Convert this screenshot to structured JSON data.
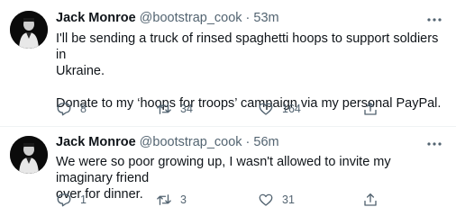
{
  "tweets": [
    {
      "name": "Jack Monroe",
      "handle": "@bootstrap_cook",
      "separator": "·",
      "time": "53m",
      "lines": [
        "I'll be sending a truck of rinsed spaghetti hoops to support soldiers in",
        "Ukraine.",
        "Donate to my ‘hoops for troops’ campaign via my personal PayPal."
      ],
      "replies": "8",
      "retweets": "34",
      "likes": "164"
    },
    {
      "name": "Jack Monroe",
      "handle": "@bootstrap_cook",
      "separator": "·",
      "time": "56m",
      "lines": [
        "We were so poor growing up, I wasn't allowed to invite my imaginary friend",
        "over for dinner."
      ],
      "replies": "1",
      "retweets": "3",
      "likes": "31"
    }
  ],
  "icons": {
    "avatar": "profile-photo",
    "more": "more-horizontal-icon",
    "reply": "reply-icon",
    "retweet": "retweet-icon",
    "like": "heart-icon",
    "share": "share-icon"
  },
  "colors": {
    "text": "#0f1419",
    "secondary": "#536471",
    "divider": "#eff3f4"
  }
}
